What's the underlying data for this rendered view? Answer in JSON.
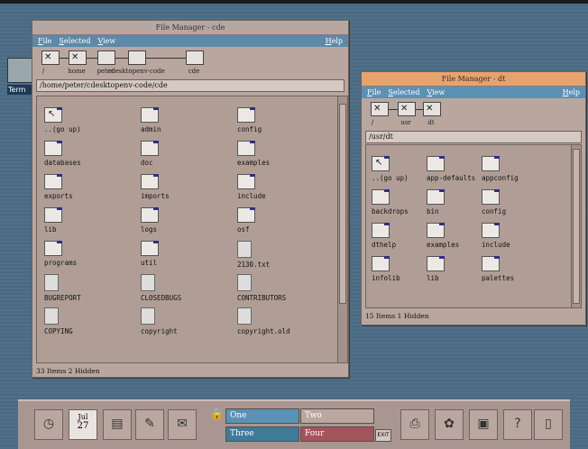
{
  "desktop": {
    "icon_label": "Term"
  },
  "win1": {
    "title": "File Manager - cde",
    "menu": [
      "File",
      "Selected",
      "View"
    ],
    "help": "Help",
    "path_icons": [
      "/",
      "home",
      "peter",
      "cdesktopenv-code",
      "cde"
    ],
    "path": "/home/peter/cdesktopenv-code/cde",
    "items": [
      {
        "label": "..(go up)",
        "type": "up"
      },
      {
        "label": "admin",
        "type": "folder"
      },
      {
        "label": "config",
        "type": "folder"
      },
      {
        "label": "databases",
        "type": "folder"
      },
      {
        "label": "doc",
        "type": "folder"
      },
      {
        "label": "examples",
        "type": "folder"
      },
      {
        "label": "exports",
        "type": "folder"
      },
      {
        "label": "imports",
        "type": "folder"
      },
      {
        "label": "include",
        "type": "folder"
      },
      {
        "label": "lib",
        "type": "folder"
      },
      {
        "label": "logs",
        "type": "folder"
      },
      {
        "label": "osf",
        "type": "folder"
      },
      {
        "label": "programs",
        "type": "folder"
      },
      {
        "label": "util",
        "type": "folder"
      },
      {
        "label": "2130.txt",
        "type": "doc"
      },
      {
        "label": "BUGREPORT",
        "type": "doc"
      },
      {
        "label": "CLOSEDBUGS",
        "type": "doc"
      },
      {
        "label": "CONTRIBUTORS",
        "type": "doc"
      },
      {
        "label": "COPYING",
        "type": "doc"
      },
      {
        "label": "copyright",
        "type": "doc"
      },
      {
        "label": "copyright.old",
        "type": "doc"
      }
    ],
    "status": "33 Items 2 Hidden"
  },
  "win2": {
    "title": "File Manager - dt",
    "menu": [
      "File",
      "Selected",
      "View"
    ],
    "help": "Help",
    "path_icons": [
      "/",
      "usr",
      "dt"
    ],
    "path": "/usr/dt",
    "items": [
      {
        "label": "..(go up)",
        "type": "up"
      },
      {
        "label": "app-defaults",
        "type": "folder"
      },
      {
        "label": "appconfig",
        "type": "folder"
      },
      {
        "label": "backdrops",
        "type": "folder"
      },
      {
        "label": "bin",
        "type": "folder"
      },
      {
        "label": "config",
        "type": "folder"
      },
      {
        "label": "dthelp",
        "type": "folder"
      },
      {
        "label": "examples",
        "type": "folder"
      },
      {
        "label": "include",
        "type": "folder"
      },
      {
        "label": "infolib",
        "type": "folder"
      },
      {
        "label": "lib",
        "type": "folder"
      },
      {
        "label": "palettes",
        "type": "folder"
      }
    ],
    "status": "15 Items 1 Hidden"
  },
  "panel": {
    "date_month": "Jul",
    "date_day": "27",
    "workspaces": [
      "One",
      "Two",
      "Three",
      "Four"
    ],
    "exit_label": "EXIT"
  }
}
